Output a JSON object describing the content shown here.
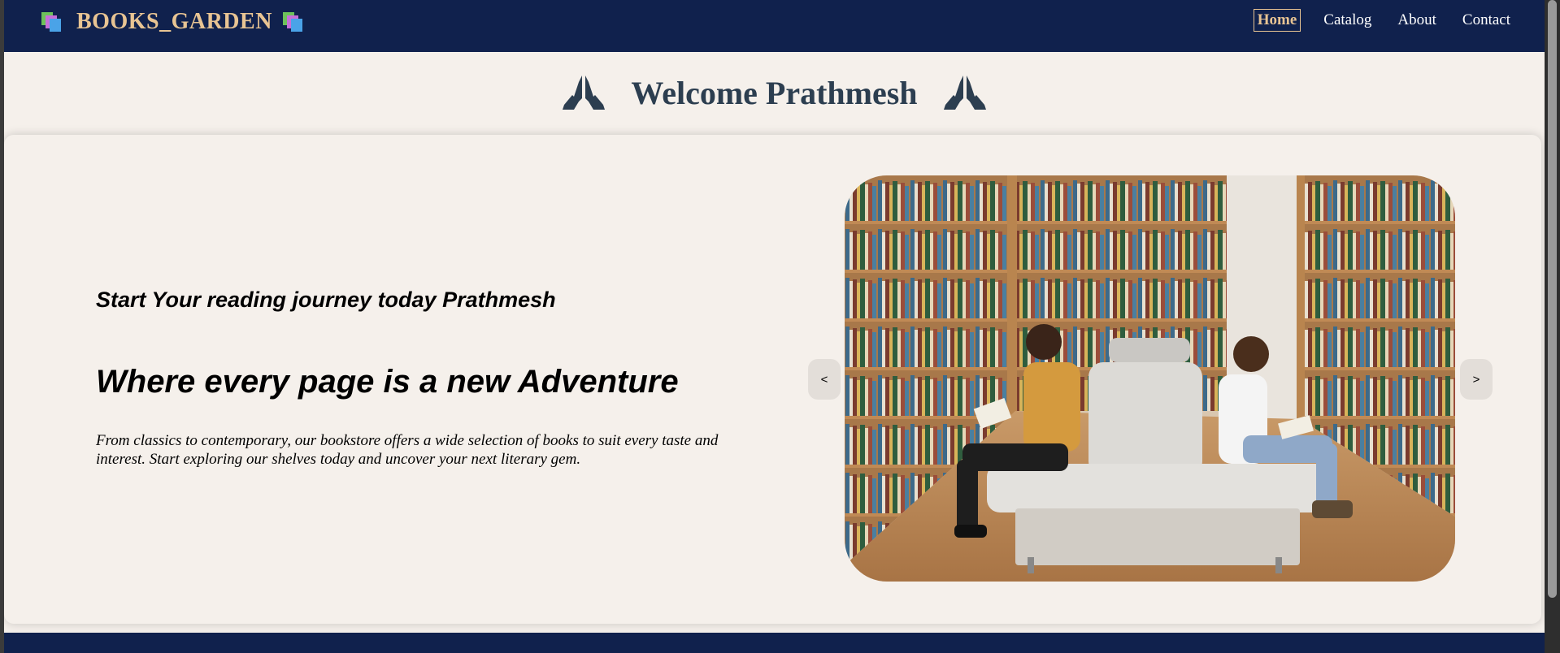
{
  "navbar": {
    "brand": "BOOKS_GARDEN",
    "brand_icon": "books-icon",
    "links": [
      {
        "label": "Home",
        "active": true
      },
      {
        "label": "Catalog",
        "active": false
      },
      {
        "label": "About",
        "active": false
      },
      {
        "label": "Contact",
        "active": false
      }
    ]
  },
  "welcome": {
    "text": "Welcome Prathmesh",
    "icon": "praying-hands-icon"
  },
  "hero": {
    "tagline": "Start Your reading journey today Prathmesh",
    "headline": "Where every page is a new Adventure",
    "description": "From classics to contemporary, our bookstore offers a wide selection of books to suit every taste and interest. Start exploring our shelves today and uncover your next literary gem.",
    "carousel": {
      "prev_label": "<",
      "next_label": ">",
      "slide_image": "library-reading-photo"
    }
  },
  "colors": {
    "navbar_bg": "#10214d",
    "brand_gold": "#e8c493",
    "page_bg": "#f5f0eb",
    "welcome_text": "#2c3e50"
  }
}
